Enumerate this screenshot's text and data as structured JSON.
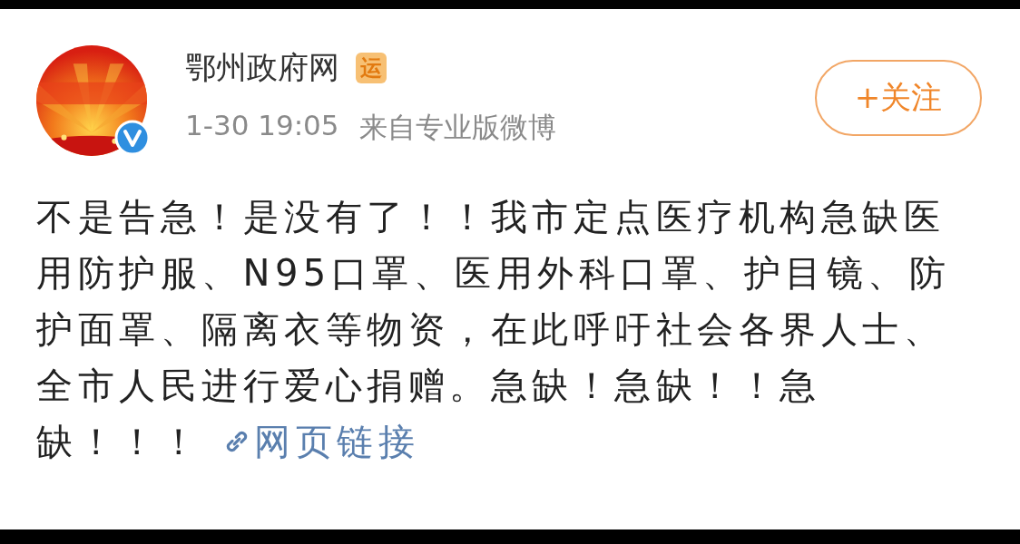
{
  "post": {
    "author": "鄂州政府网",
    "badge": "运",
    "verified": true,
    "time": "1-30 19:05",
    "source": "来自专业版微博",
    "follow_button": "+关注",
    "text": "不是告急！是没有了！！我市定点医疗机构急缺医用防护服、N95口罩、医用外科口罩、护目镜、防护面罩、隔离衣等物资，在此呼吁社会各界人士、全市人民进行爱心捐赠。急缺！急缺！！急缺！！！",
    "link": "网页链接"
  }
}
